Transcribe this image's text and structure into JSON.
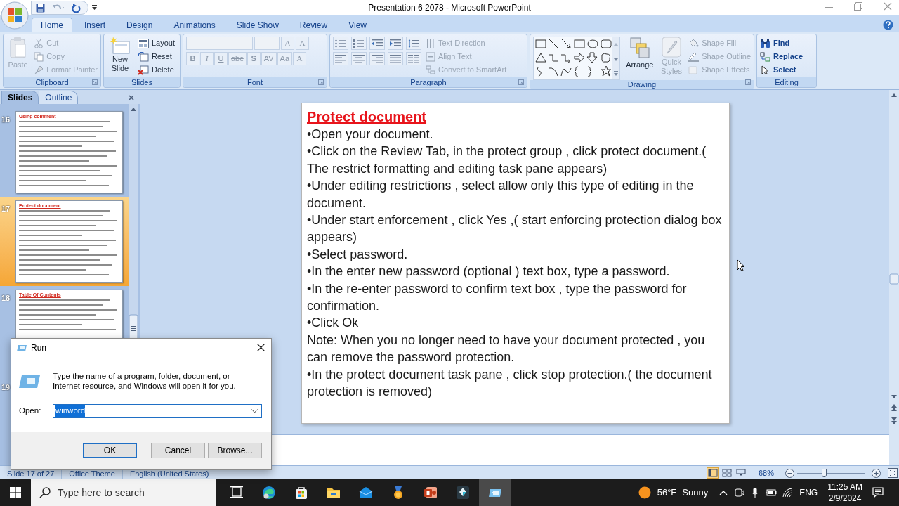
{
  "window": {
    "title": "Presentation 6 2078 - Microsoft PowerPoint"
  },
  "ribbon_tabs": [
    {
      "label": "Home",
      "selected": true
    },
    {
      "label": "Insert",
      "selected": false
    },
    {
      "label": "Design",
      "selected": false
    },
    {
      "label": "Animations",
      "selected": false
    },
    {
      "label": "Slide Show",
      "selected": false
    },
    {
      "label": "Review",
      "selected": false
    },
    {
      "label": "View",
      "selected": false
    }
  ],
  "ribbon_groups": [
    {
      "kind": "clipboard",
      "label": "Clipboard",
      "items": [
        {
          "label": "Paste",
          "disabled": true
        },
        {
          "label": "Cut",
          "disabled": true
        },
        {
          "label": "Copy",
          "disabled": true
        },
        {
          "label": "Format Painter",
          "disabled": true
        }
      ]
    },
    {
      "kind": "slides",
      "label": "Slides",
      "items": [
        {
          "label": "New Slide",
          "disabled": false
        },
        {
          "label": "Layout",
          "disabled": false
        },
        {
          "label": "Reset",
          "disabled": false
        },
        {
          "label": "Delete",
          "disabled": false
        }
      ]
    },
    {
      "kind": "font",
      "label": "Font",
      "items": [
        {
          "label": "A",
          "disabled": true
        },
        {
          "label": "A",
          "disabled": true
        },
        {
          "label": "B",
          "disabled": true
        },
        {
          "label": "I",
          "disabled": true
        },
        {
          "label": "U",
          "disabled": true
        },
        {
          "label": "abc",
          "disabled": true
        },
        {
          "label": "S",
          "disabled": true
        },
        {
          "label": "AV",
          "disabled": true
        },
        {
          "label": "Aa",
          "disabled": true
        },
        {
          "label": "A",
          "disabled": true
        }
      ]
    },
    {
      "kind": "paragraph",
      "label": "Paragraph",
      "items": [
        {
          "label": "Text Direction",
          "disabled": true
        },
        {
          "label": "Align Text",
          "disabled": true
        },
        {
          "label": "Convert to SmartArt",
          "disabled": true
        }
      ]
    },
    {
      "kind": "drawing",
      "label": "Drawing",
      "items": [
        {
          "label": "Arrange",
          "disabled": false
        },
        {
          "label": "Quick Styles",
          "disabled": true
        },
        {
          "label": "Shape Fill",
          "disabled": true
        },
        {
          "label": "Shape Outline",
          "disabled": true
        },
        {
          "label": "Shape Effects",
          "disabled": true
        }
      ]
    },
    {
      "kind": "editing",
      "label": "Editing",
      "items": [
        {
          "label": "Find",
          "disabled": false
        },
        {
          "label": "Replace",
          "disabled": false
        },
        {
          "label": "Select",
          "disabled": false
        }
      ]
    }
  ],
  "slides_panel": {
    "tabs": [
      {
        "label": "Slides",
        "selected": true
      },
      {
        "label": "Outline",
        "selected": false
      }
    ],
    "thumbnails": [
      {
        "number": "16",
        "title": "Using comment",
        "selected": false
      },
      {
        "number": "17",
        "title": "Protect document",
        "selected": true
      },
      {
        "number": "18",
        "title": "Table Of Contents",
        "selected": false
      },
      {
        "number": "19",
        "selected": false
      }
    ]
  },
  "slide": {
    "title": "Protect document",
    "paragraphs": [
      "•Open your document.",
      "•Click on the Review Tab, in the protect group , click protect document.( The restrict formatting and editing task pane appears)",
      "•Under editing restrictions , select allow only this type of editing in the document.",
      "•Under start enforcement , click Yes ,( start enforcing protection dialog box appears)",
      "•Select password.",
      "•In the enter new password (optional ) text box, type a password.",
      "•In the re-enter password to confirm text box , type the password for confirmation.",
      "•Click Ok",
      "Note: When you no longer need to have your document protected , you can remove the password protection.",
      "•In the protect document task pane , click stop protection.( the document protection is removed)"
    ]
  },
  "status_bar": {
    "items": [
      "Slide 17 of 27",
      "Office Theme",
      "English (United States)"
    ],
    "views": [
      {
        "kind": "normal",
        "selected": true
      },
      {
        "kind": "sorter",
        "selected": false
      },
      {
        "kind": "show",
        "selected": false
      }
    ],
    "zoom": "68%",
    "zoom_level": {
      "level": 0.4
    }
  },
  "run_dialog": {
    "title": "Run",
    "description": "Type the name of a program, folder, document, or Internet resource, and Windows will open it for you.",
    "open_label": "Open:",
    "value": "winword",
    "value_selected": true,
    "buttons": [
      {
        "label": "OK",
        "default": true
      },
      {
        "label": "Cancel",
        "default": false
      },
      {
        "label": "Browse...",
        "default": false
      }
    ]
  },
  "taskbar": {
    "search_placeholder": "Type here to search",
    "apps": [
      {
        "kind": "task-view",
        "selected": false
      },
      {
        "kind": "edge",
        "selected": false
      },
      {
        "kind": "store",
        "selected": false
      },
      {
        "kind": "explorer",
        "selected": false
      },
      {
        "kind": "mail",
        "selected": false
      },
      {
        "kind": "award",
        "selected": false
      },
      {
        "kind": "powerpoint",
        "selected": false
      },
      {
        "kind": "editor",
        "selected": false
      },
      {
        "kind": "run",
        "selected": true
      }
    ],
    "weather": {
      "temperature": "56°F",
      "condition": "Sunny"
    },
    "language": "ENG",
    "time": "11:25 AM",
    "date": "2/9/2024"
  }
}
